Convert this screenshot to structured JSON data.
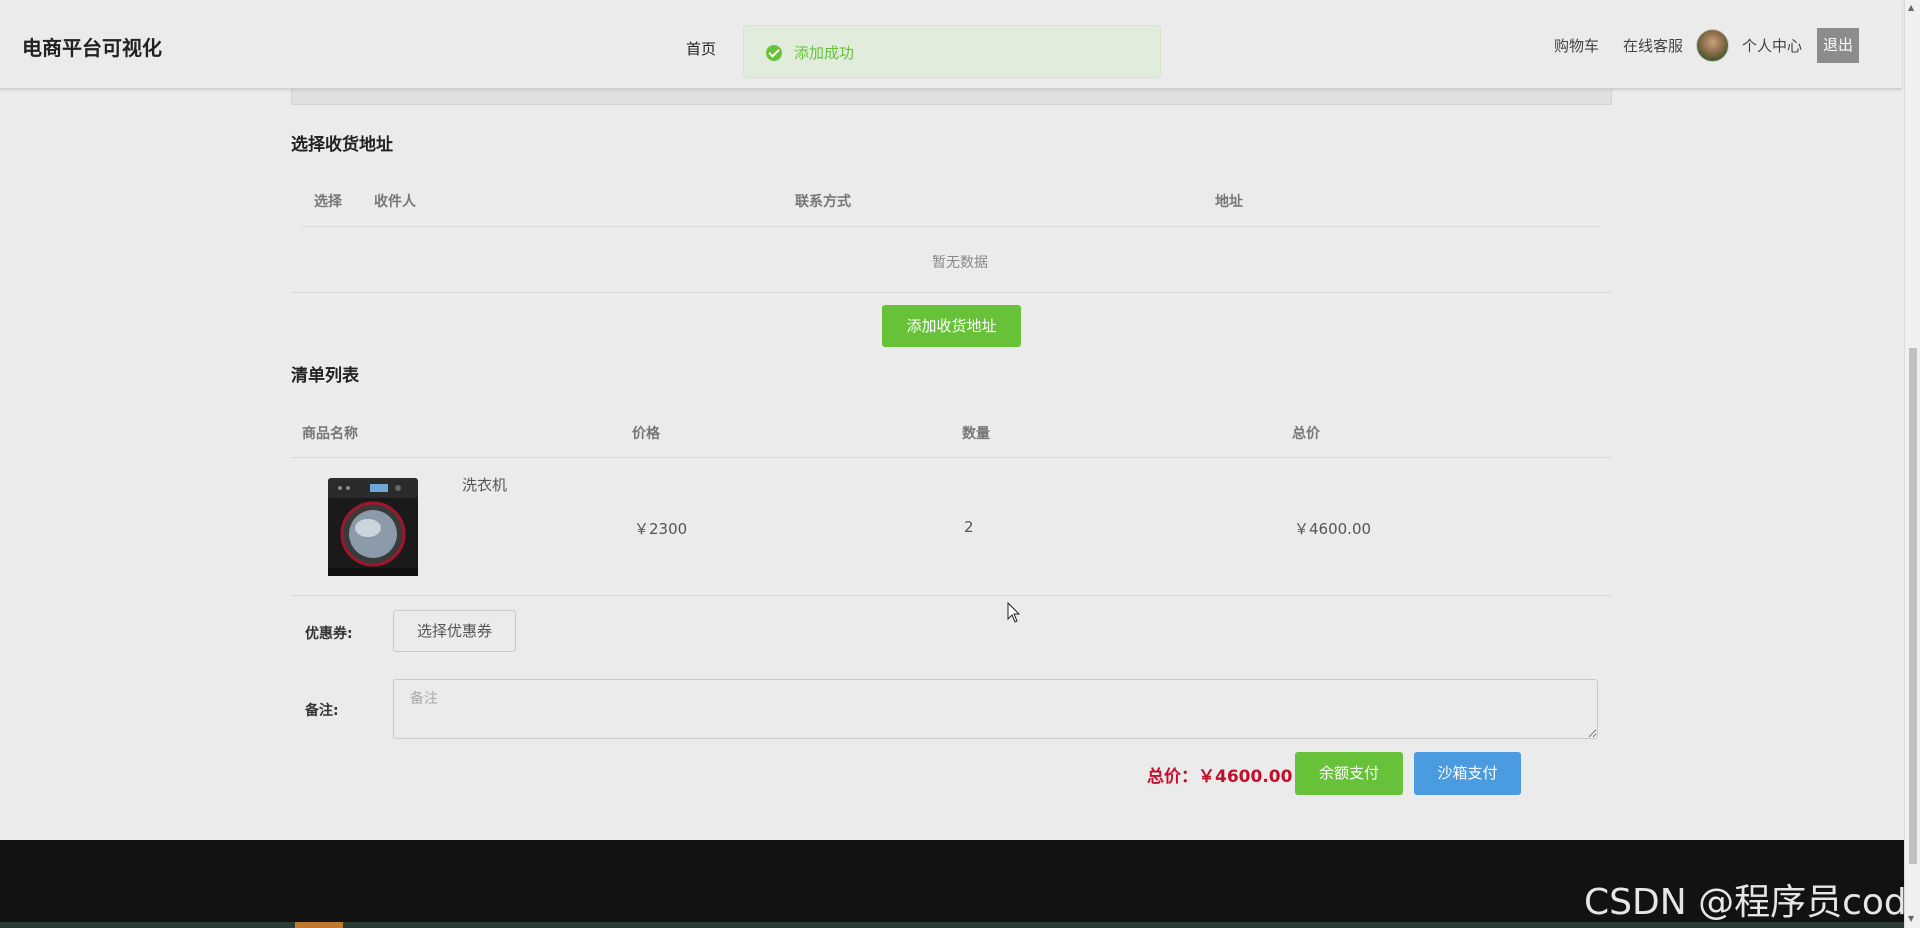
{
  "header": {
    "brand": "电商平台可视化",
    "nav_home": "首页",
    "toast": "添加成功",
    "cart": "购物车",
    "service": "在线客服",
    "profile": "个人中心",
    "logout": "退出"
  },
  "address": {
    "title": "选择收货地址",
    "columns": [
      "选择",
      "收件人",
      "联系方式",
      "地址"
    ],
    "empty_text": "暂无数据",
    "add_button": "添加收货地址"
  },
  "order": {
    "title": "清单列表",
    "columns": [
      "商品名称",
      "价格",
      "数量",
      "总价"
    ],
    "items": [
      {
        "name": "洗衣机",
        "price": "￥2300",
        "quantity": "2",
        "subtotal": "￥4600.00"
      }
    ]
  },
  "form": {
    "coupon_label": "优惠券:",
    "coupon_button": "选择优惠券",
    "remark_label": "备注:",
    "remark_placeholder": "备注",
    "remark_value": ""
  },
  "payment": {
    "total": "总价：￥4600.00",
    "balance_pay": "余额支付",
    "sandbox_pay": "沙箱支付"
  },
  "watermark": "CSDN @程序员code",
  "colors": {
    "success": "#67c23a",
    "primary": "#4a9be0",
    "price_red": "#c0102a",
    "footer": "#121212"
  }
}
